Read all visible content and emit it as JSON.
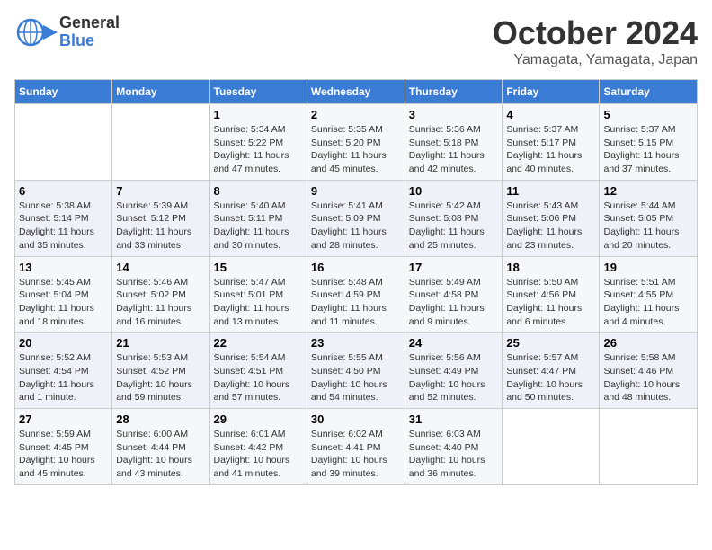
{
  "header": {
    "logo_line1": "General",
    "logo_line2": "Blue",
    "month": "October 2024",
    "location": "Yamagata, Yamagata, Japan"
  },
  "columns": [
    "Sunday",
    "Monday",
    "Tuesday",
    "Wednesday",
    "Thursday",
    "Friday",
    "Saturday"
  ],
  "weeks": [
    [
      {
        "day": "",
        "sunrise": "",
        "sunset": "",
        "daylight": ""
      },
      {
        "day": "",
        "sunrise": "",
        "sunset": "",
        "daylight": ""
      },
      {
        "day": "1",
        "sunrise": "Sunrise: 5:34 AM",
        "sunset": "Sunset: 5:22 PM",
        "daylight": "Daylight: 11 hours and 47 minutes."
      },
      {
        "day": "2",
        "sunrise": "Sunrise: 5:35 AM",
        "sunset": "Sunset: 5:20 PM",
        "daylight": "Daylight: 11 hours and 45 minutes."
      },
      {
        "day": "3",
        "sunrise": "Sunrise: 5:36 AM",
        "sunset": "Sunset: 5:18 PM",
        "daylight": "Daylight: 11 hours and 42 minutes."
      },
      {
        "day": "4",
        "sunrise": "Sunrise: 5:37 AM",
        "sunset": "Sunset: 5:17 PM",
        "daylight": "Daylight: 11 hours and 40 minutes."
      },
      {
        "day": "5",
        "sunrise": "Sunrise: 5:37 AM",
        "sunset": "Sunset: 5:15 PM",
        "daylight": "Daylight: 11 hours and 37 minutes."
      }
    ],
    [
      {
        "day": "6",
        "sunrise": "Sunrise: 5:38 AM",
        "sunset": "Sunset: 5:14 PM",
        "daylight": "Daylight: 11 hours and 35 minutes."
      },
      {
        "day": "7",
        "sunrise": "Sunrise: 5:39 AM",
        "sunset": "Sunset: 5:12 PM",
        "daylight": "Daylight: 11 hours and 33 minutes."
      },
      {
        "day": "8",
        "sunrise": "Sunrise: 5:40 AM",
        "sunset": "Sunset: 5:11 PM",
        "daylight": "Daylight: 11 hours and 30 minutes."
      },
      {
        "day": "9",
        "sunrise": "Sunrise: 5:41 AM",
        "sunset": "Sunset: 5:09 PM",
        "daylight": "Daylight: 11 hours and 28 minutes."
      },
      {
        "day": "10",
        "sunrise": "Sunrise: 5:42 AM",
        "sunset": "Sunset: 5:08 PM",
        "daylight": "Daylight: 11 hours and 25 minutes."
      },
      {
        "day": "11",
        "sunrise": "Sunrise: 5:43 AM",
        "sunset": "Sunset: 5:06 PM",
        "daylight": "Daylight: 11 hours and 23 minutes."
      },
      {
        "day": "12",
        "sunrise": "Sunrise: 5:44 AM",
        "sunset": "Sunset: 5:05 PM",
        "daylight": "Daylight: 11 hours and 20 minutes."
      }
    ],
    [
      {
        "day": "13",
        "sunrise": "Sunrise: 5:45 AM",
        "sunset": "Sunset: 5:04 PM",
        "daylight": "Daylight: 11 hours and 18 minutes."
      },
      {
        "day": "14",
        "sunrise": "Sunrise: 5:46 AM",
        "sunset": "Sunset: 5:02 PM",
        "daylight": "Daylight: 11 hours and 16 minutes."
      },
      {
        "day": "15",
        "sunrise": "Sunrise: 5:47 AM",
        "sunset": "Sunset: 5:01 PM",
        "daylight": "Daylight: 11 hours and 13 minutes."
      },
      {
        "day": "16",
        "sunrise": "Sunrise: 5:48 AM",
        "sunset": "Sunset: 4:59 PM",
        "daylight": "Daylight: 11 hours and 11 minutes."
      },
      {
        "day": "17",
        "sunrise": "Sunrise: 5:49 AM",
        "sunset": "Sunset: 4:58 PM",
        "daylight": "Daylight: 11 hours and 9 minutes."
      },
      {
        "day": "18",
        "sunrise": "Sunrise: 5:50 AM",
        "sunset": "Sunset: 4:56 PM",
        "daylight": "Daylight: 11 hours and 6 minutes."
      },
      {
        "day": "19",
        "sunrise": "Sunrise: 5:51 AM",
        "sunset": "Sunset: 4:55 PM",
        "daylight": "Daylight: 11 hours and 4 minutes."
      }
    ],
    [
      {
        "day": "20",
        "sunrise": "Sunrise: 5:52 AM",
        "sunset": "Sunset: 4:54 PM",
        "daylight": "Daylight: 11 hours and 1 minute."
      },
      {
        "day": "21",
        "sunrise": "Sunrise: 5:53 AM",
        "sunset": "Sunset: 4:52 PM",
        "daylight": "Daylight: 10 hours and 59 minutes."
      },
      {
        "day": "22",
        "sunrise": "Sunrise: 5:54 AM",
        "sunset": "Sunset: 4:51 PM",
        "daylight": "Daylight: 10 hours and 57 minutes."
      },
      {
        "day": "23",
        "sunrise": "Sunrise: 5:55 AM",
        "sunset": "Sunset: 4:50 PM",
        "daylight": "Daylight: 10 hours and 54 minutes."
      },
      {
        "day": "24",
        "sunrise": "Sunrise: 5:56 AM",
        "sunset": "Sunset: 4:49 PM",
        "daylight": "Daylight: 10 hours and 52 minutes."
      },
      {
        "day": "25",
        "sunrise": "Sunrise: 5:57 AM",
        "sunset": "Sunset: 4:47 PM",
        "daylight": "Daylight: 10 hours and 50 minutes."
      },
      {
        "day": "26",
        "sunrise": "Sunrise: 5:58 AM",
        "sunset": "Sunset: 4:46 PM",
        "daylight": "Daylight: 10 hours and 48 minutes."
      }
    ],
    [
      {
        "day": "27",
        "sunrise": "Sunrise: 5:59 AM",
        "sunset": "Sunset: 4:45 PM",
        "daylight": "Daylight: 10 hours and 45 minutes."
      },
      {
        "day": "28",
        "sunrise": "Sunrise: 6:00 AM",
        "sunset": "Sunset: 4:44 PM",
        "daylight": "Daylight: 10 hours and 43 minutes."
      },
      {
        "day": "29",
        "sunrise": "Sunrise: 6:01 AM",
        "sunset": "Sunset: 4:42 PM",
        "daylight": "Daylight: 10 hours and 41 minutes."
      },
      {
        "day": "30",
        "sunrise": "Sunrise: 6:02 AM",
        "sunset": "Sunset: 4:41 PM",
        "daylight": "Daylight: 10 hours and 39 minutes."
      },
      {
        "day": "31",
        "sunrise": "Sunrise: 6:03 AM",
        "sunset": "Sunset: 4:40 PM",
        "daylight": "Daylight: 10 hours and 36 minutes."
      },
      {
        "day": "",
        "sunrise": "",
        "sunset": "",
        "daylight": ""
      },
      {
        "day": "",
        "sunrise": "",
        "sunset": "",
        "daylight": ""
      }
    ]
  ]
}
